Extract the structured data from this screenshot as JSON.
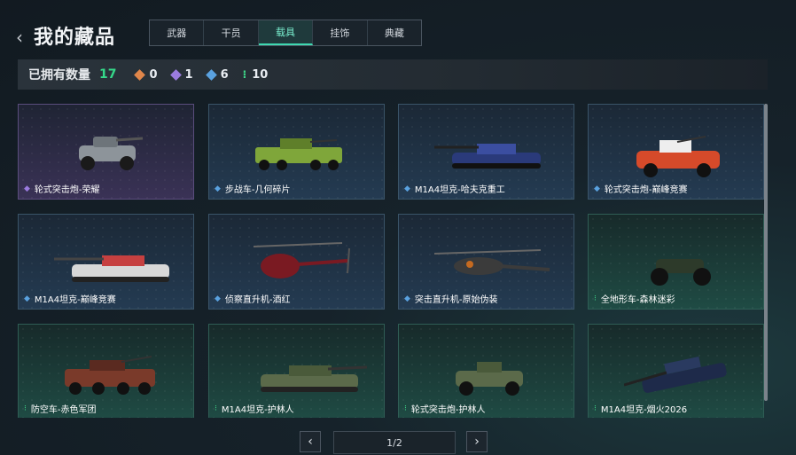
{
  "header": {
    "back_icon": "chevron-left-icon",
    "title": "我的藏品"
  },
  "tabs": [
    {
      "label": "武器",
      "active": false
    },
    {
      "label": "干员",
      "active": false
    },
    {
      "label": "载具",
      "active": true
    },
    {
      "label": "挂饰",
      "active": false
    },
    {
      "label": "典藏",
      "active": false
    }
  ],
  "stats": {
    "label": "已拥有数量",
    "count": "17",
    "rarities": [
      {
        "icon": "orange-diamond-icon",
        "color": "#e0864a",
        "value": "0"
      },
      {
        "icon": "purple-diamond-icon",
        "color": "#9b7bdf",
        "value": "1"
      },
      {
        "icon": "blue-diamond-icon",
        "color": "#5aa2e0",
        "value": "6"
      },
      {
        "icon": "green-dots-icon",
        "color": "#3fd98a",
        "value": "10"
      }
    ]
  },
  "items": [
    {
      "name": "轮式突击炮-荣耀",
      "rarity": "purple",
      "icon": "purple-diamond-icon"
    },
    {
      "name": "步战车-几何碎片",
      "rarity": "blue",
      "icon": "blue-diamond-icon"
    },
    {
      "name": "M1A4坦克-哈夫克重工",
      "rarity": "blue",
      "icon": "blue-diamond-icon"
    },
    {
      "name": "轮式突击炮-巅峰竞赛",
      "rarity": "blue",
      "icon": "blue-diamond-icon"
    },
    {
      "name": "M1A4坦克-巅峰竞赛",
      "rarity": "blue",
      "icon": "blue-diamond-icon"
    },
    {
      "name": "侦察直升机-酒红",
      "rarity": "blue",
      "icon": "blue-diamond-icon"
    },
    {
      "name": "突击直升机-原始伪装",
      "rarity": "blue",
      "icon": "blue-diamond-icon"
    },
    {
      "name": "全地形车-森林迷彩",
      "rarity": "green",
      "icon": "green-dots-icon"
    },
    {
      "name": "防空车-赤色军团",
      "rarity": "green",
      "icon": "green-dots-icon"
    },
    {
      "name": "M1A4坦克-护林人",
      "rarity": "green",
      "icon": "green-dots-icon"
    },
    {
      "name": "轮式突击炮-护林人",
      "rarity": "green",
      "icon": "green-dots-icon"
    },
    {
      "name": "M1A4坦克-烟火2026",
      "rarity": "green",
      "icon": "green-dots-icon"
    }
  ],
  "pager": {
    "prev_icon": "chevron-left-icon",
    "next_icon": "chevron-right-icon",
    "text": "1/2"
  }
}
